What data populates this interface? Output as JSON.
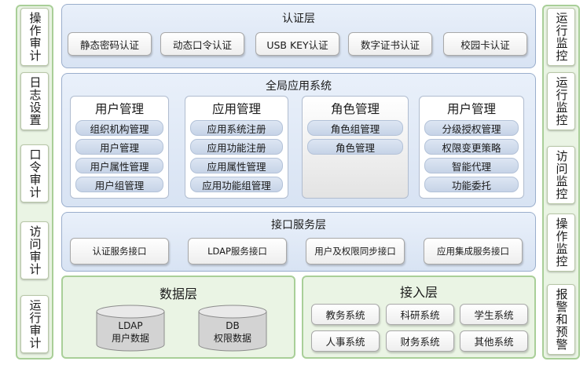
{
  "left_column": [
    "操作审计",
    "日志设置",
    "口令审计",
    "访问审计",
    "运行审计"
  ],
  "right_column": [
    "运行监控",
    "运行监控",
    "访问监控",
    "操作监控",
    "报警和预警"
  ],
  "auth_layer": {
    "title": "认证层",
    "items": [
      "静态密码认证",
      "动态口令认证",
      "USB KEY认证",
      "数字证书认证",
      "校园卡认证"
    ]
  },
  "app_layer": {
    "title": "全局应用系统",
    "modules": [
      {
        "title": "用户管理",
        "items": [
          "组织机构管理",
          "用户管理",
          "用户属性管理",
          "用户组管理"
        ]
      },
      {
        "title": "应用管理",
        "items": [
          "应用系统注册",
          "应用功能注册",
          "应用属性管理",
          "应用功能组管理"
        ]
      },
      {
        "title": "角色管理",
        "items": [
          "角色组管理",
          "角色管理"
        ]
      },
      {
        "title": "用户管理",
        "items": [
          "分级授权管理",
          "权限变更策略",
          "智能代理",
          "功能委托"
        ]
      }
    ]
  },
  "interface_layer": {
    "title": "接口服务层",
    "items": [
      "认证服务接口",
      "LDAP服务接口",
      "用户及权限同步接口",
      "应用集成服务接口"
    ]
  },
  "data_layer": {
    "title": "数据层",
    "stores": [
      {
        "line1": "LDAP",
        "line2": "用户数据"
      },
      {
        "line1": "DB",
        "line2": "权限数据"
      }
    ]
  },
  "access_layer": {
    "title": "接入层",
    "items": [
      "教务系统",
      "科研系统",
      "学生系统",
      "人事系统",
      "财务系统",
      "其他系统"
    ]
  }
}
